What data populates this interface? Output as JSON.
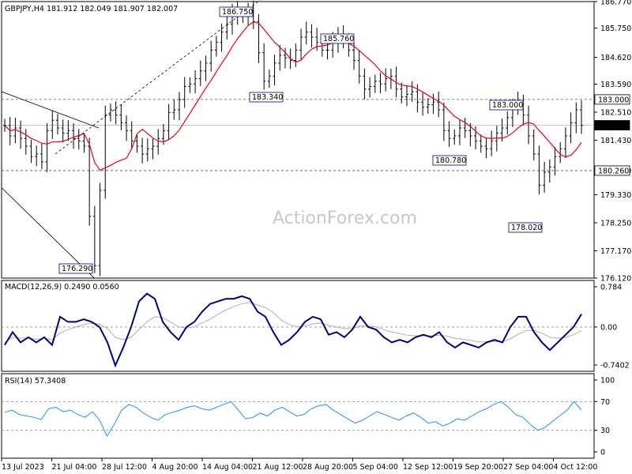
{
  "header": {
    "symbol": "GBPJPY,H4",
    "ohlc": "181.912 182.049 181.907 182.007"
  },
  "watermark": "ActionForex.com",
  "colors": {
    "bars": "#000000",
    "ma": "#e8001c",
    "macd": "#00007f",
    "signal": "#b0b0b0",
    "rsi": "#1e8fff",
    "grid": "#808080"
  },
  "chart_data": [
    {
      "type": "ohlc",
      "name": "GBPJPY,H4",
      "y_ticks": [
        "186.770",
        "185.750",
        "184.620",
        "183.590",
        "182.510",
        "181.430",
        "180.260",
        "179.330",
        "178.250",
        "177.170",
        "176.120"
      ],
      "ylim": [
        176.12,
        186.77
      ],
      "current_price_label": "182.007",
      "level_labels": [
        "183.000",
        "180.260"
      ],
      "levels": [
        183.0,
        180.26,
        182.007
      ],
      "annotations": [
        {
          "label": "186.750",
          "value": 186.75
        },
        {
          "label": "185.760",
          "value": 185.76
        },
        {
          "label": "183.340",
          "value": 183.34
        },
        {
          "label": "183.000",
          "value": 183.0
        },
        {
          "label": "180.780",
          "value": 180.78
        },
        {
          "label": "178.020",
          "value": 178.02
        },
        {
          "label": "176.290",
          "value": 176.29
        }
      ],
      "x_labels": [
        "13 Jul 2023",
        "21 Jul 04:00",
        "28 Jul 12:00",
        "4 Aug 20:00",
        "14 Aug 04:00",
        "21 Aug 12:00",
        "28 Aug 20:00",
        "5 Sep 04:00",
        "12 Sep 12:00",
        "19 Sep 20:00",
        "27 Sep 04:00",
        "4 Oct 12:00"
      ],
      "close": [
        182.0,
        181.6,
        181.9,
        181.5,
        181.2,
        180.8,
        180.9,
        180.6,
        181.8,
        182.2,
        181.9,
        181.7,
        181.8,
        181.5,
        181.4,
        181.2,
        178.5,
        176.6,
        179.5,
        182.4,
        182.6,
        182.4,
        182.1,
        181.8,
        181.4,
        181.2,
        180.9,
        181.1,
        181.2,
        181.5,
        181.8,
        182.5,
        182.6,
        183.0,
        183.5,
        183.6,
        183.8,
        184.1,
        184.4,
        184.9,
        185.2,
        185.6,
        185.9,
        186.4,
        186.2,
        186.2,
        186.4,
        186.0,
        184.8,
        183.7,
        183.9,
        184.4,
        184.7,
        184.6,
        184.5,
        184.9,
        185.4,
        185.6,
        185.4,
        185.2,
        184.9,
        184.9,
        185.2,
        185.5,
        185.3,
        184.9,
        184.5,
        183.9,
        183.4,
        183.5,
        183.7,
        183.6,
        183.8,
        183.9,
        183.4,
        183.1,
        183.2,
        183.3,
        182.9,
        182.7,
        182.8,
        182.9,
        182.6,
        181.8,
        181.5,
        181.6,
        181.9,
        181.8,
        181.6,
        181.4,
        181.2,
        181.1,
        181.4,
        181.7,
        181.9,
        182.3,
        182.7,
        182.9,
        182.4,
        181.6,
        180.9,
        179.7,
        180.2,
        180.4,
        180.8,
        181.1,
        181.6,
        182.1,
        182.6,
        182.0
      ]
    },
    {
      "type": "line",
      "title": "MACD(12,26,9) 0.2490 0.0560",
      "y_ticks": [
        "0.784",
        "0.00",
        "-0.7402"
      ],
      "ylim": [
        -0.7402,
        0.784
      ],
      "series": [
        {
          "name": "MACD",
          "values": [
            -0.35,
            -0.1,
            -0.3,
            -0.2,
            -0.3,
            -0.2,
            -0.35,
            0.2,
            0.1,
            0.1,
            0.15,
            0.1,
            0.0,
            -0.3,
            -0.75,
            -0.4,
            0.0,
            0.5,
            0.65,
            0.55,
            0.1,
            -0.1,
            -0.25,
            0.0,
            0.1,
            0.3,
            0.45,
            0.5,
            0.55,
            0.55,
            0.6,
            0.55,
            0.3,
            0.2,
            -0.1,
            -0.35,
            -0.25,
            -0.1,
            0.1,
            0.2,
            0.15,
            -0.15,
            -0.1,
            -0.2,
            -0.05,
            0.2,
            0.0,
            -0.05,
            -0.2,
            -0.3,
            -0.25,
            -0.3,
            -0.2,
            -0.15,
            -0.2,
            -0.1,
            -0.3,
            -0.4,
            -0.3,
            -0.35,
            -0.4,
            -0.3,
            -0.25,
            -0.3,
            0.0,
            0.2,
            0.2,
            -0.1,
            -0.3,
            -0.45,
            -0.3,
            -0.15,
            0.0,
            0.25
          ]
        },
        {
          "name": "Signal",
          "values": [
            -0.3,
            -0.2,
            -0.22,
            -0.21,
            -0.24,
            -0.22,
            -0.25,
            -0.12,
            -0.05,
            0.0,
            0.05,
            0.07,
            0.06,
            -0.03,
            -0.2,
            -0.25,
            -0.2,
            -0.05,
            0.1,
            0.2,
            0.18,
            0.1,
            0.0,
            -0.02,
            0.0,
            0.08,
            0.15,
            0.25,
            0.33,
            0.4,
            0.45,
            0.48,
            0.43,
            0.38,
            0.28,
            0.13,
            0.05,
            0.0,
            0.02,
            0.06,
            0.08,
            0.03,
            0.0,
            -0.03,
            -0.03,
            0.02,
            0.02,
            0.0,
            -0.05,
            -0.1,
            -0.13,
            -0.16,
            -0.17,
            -0.17,
            -0.17,
            -0.16,
            -0.18,
            -0.22,
            -0.24,
            -0.26,
            -0.29,
            -0.29,
            -0.28,
            -0.29,
            -0.23,
            -0.14,
            -0.07,
            -0.07,
            -0.12,
            -0.2,
            -0.22,
            -0.2,
            -0.15,
            -0.07
          ]
        }
      ]
    },
    {
      "type": "line",
      "title": "RSI(14) 57.3408",
      "y_ticks": [
        "100",
        "70",
        "30",
        "0"
      ],
      "ylim": [
        0,
        100
      ],
      "series": [
        {
          "name": "RSI",
          "values": [
            55,
            58,
            52,
            50,
            48,
            45,
            60,
            62,
            56,
            58,
            52,
            48,
            56,
            44,
            22,
            38,
            58,
            66,
            62,
            54,
            48,
            44,
            52,
            55,
            58,
            62,
            64,
            60,
            58,
            62,
            66,
            70,
            58,
            46,
            48,
            54,
            50,
            58,
            62,
            56,
            50,
            52,
            60,
            64,
            66,
            58,
            52,
            46,
            40,
            44,
            50,
            56,
            52,
            48,
            44,
            50,
            54,
            48,
            40,
            42,
            36,
            40,
            46,
            44,
            50,
            56,
            60,
            66,
            70,
            62,
            52,
            48,
            38,
            30,
            34,
            42,
            50,
            58,
            70,
            58
          ]
        }
      ]
    }
  ]
}
